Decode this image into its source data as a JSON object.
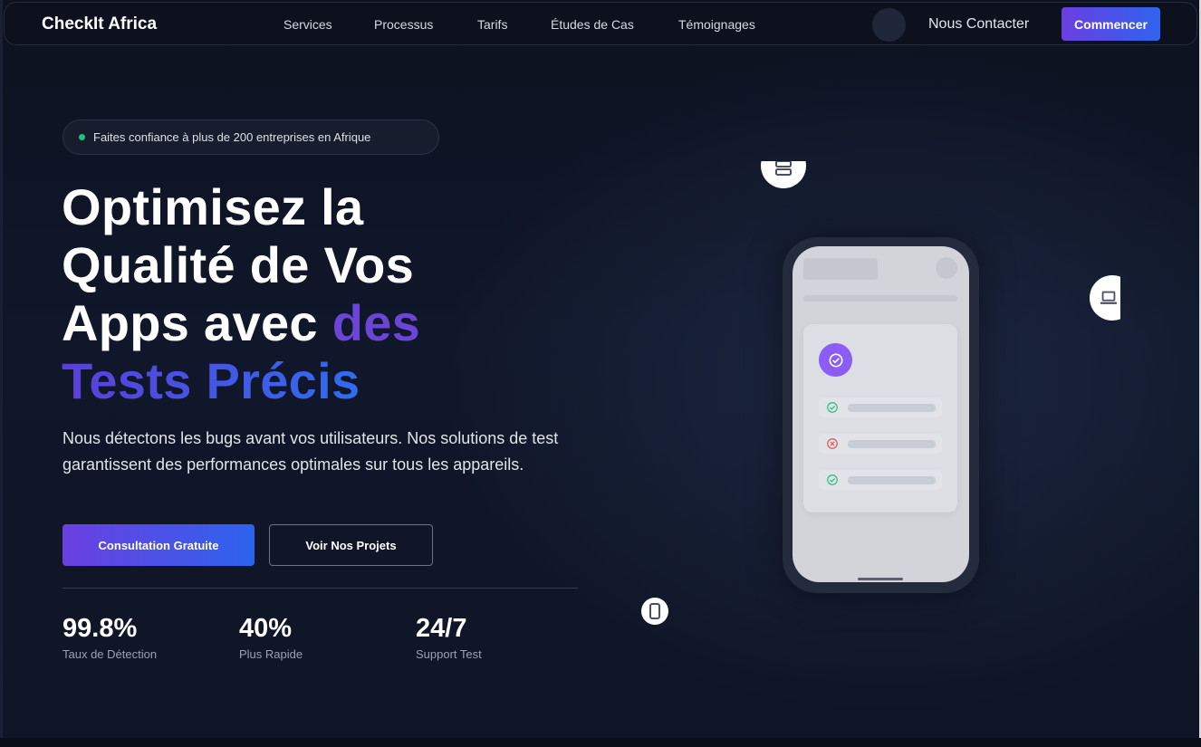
{
  "nav": {
    "brand": "CheckIt Africa",
    "links": [
      "Services",
      "Processus",
      "Tarifs",
      "Études de Cas",
      "Témoignages"
    ],
    "contact": "Nous Contacter",
    "cta": "Commencer"
  },
  "hero": {
    "badge": "Faites confiance à plus de 200 entreprises en Afrique",
    "title": {
      "line1": "Optimisez la",
      "line2": "Qualité de Vos",
      "line3_plain": "Apps avec ",
      "line3_accent": "des",
      "line4": "Tests Précis"
    },
    "lead": "Nous détectons les bugs avant vos utilisateurs. Nos solutions de test garantissent des performances optimales sur tous les appareils.",
    "primary_button": "Consultation Gratuite",
    "secondary_button": "Voir Nos Projets",
    "stats": [
      {
        "value": "99.8%",
        "label": "Taux de Détection"
      },
      {
        "value": "40%",
        "label": "Plus Rapide"
      },
      {
        "value": "24/7",
        "label": "Support Test"
      }
    ]
  },
  "illustration": {
    "icons": [
      "server-icon",
      "laptop-icon",
      "phone-icon",
      "check-circle-icon",
      "x-circle-icon"
    ],
    "check_rows": [
      "pass",
      "fail",
      "pass"
    ],
    "colors": {
      "accent": "#8b5cf6",
      "pass": "#22c07a",
      "fail": "#e05252"
    }
  }
}
